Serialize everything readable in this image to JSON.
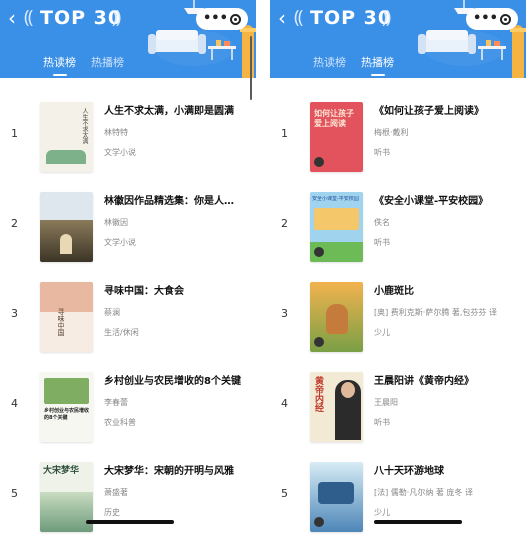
{
  "colors": {
    "header": "#3a8fe6",
    "tab_inactive": "#cfe4fb",
    "tab_active": "#ffffff"
  },
  "left_panel": {
    "back_icon": "chevron-left-icon",
    "title": "TOP 30",
    "tabs": [
      {
        "label": "热读榜",
        "active": true
      },
      {
        "label": "热播榜",
        "active": false
      }
    ],
    "books": [
      {
        "rank": "1",
        "title": "人生不求太满，小满即是圆满",
        "author": "林特特",
        "category": "文学小说"
      },
      {
        "rank": "2",
        "title": "林徽因作品精选集：你是人…",
        "author": "林徽因",
        "category": "文学小说"
      },
      {
        "rank": "3",
        "title": "寻味中国：大食会",
        "author": "蔡澜",
        "category": "生活/休闲"
      },
      {
        "rank": "4",
        "title": "乡村创业与农民增收的8个关键",
        "author": "李春蕾",
        "category": "农业科普"
      },
      {
        "rank": "5",
        "title": "大宋梦华：宋朝的开明与风雅",
        "author": "萧盛著",
        "category": "历史"
      }
    ]
  },
  "right_panel": {
    "back_icon": "chevron-left-icon",
    "title": "TOP 30",
    "tabs": [
      {
        "label": "热读榜",
        "active": false
      },
      {
        "label": "热播榜",
        "active": true
      }
    ],
    "books": [
      {
        "rank": "1",
        "title": "《如何让孩子爱上阅读》",
        "author": "梅根·戴利",
        "category": "听书"
      },
      {
        "rank": "2",
        "title": "《安全小课堂-平安校园》",
        "author": "佚名",
        "category": "听书"
      },
      {
        "rank": "3",
        "title": "小鹿斑比",
        "author": "[奥] 费利克斯·萨尔腾 著,包芬芬 译",
        "category": "少儿"
      },
      {
        "rank": "4",
        "title": "王晨阳讲《黄帝内经》",
        "author": "王晨阳",
        "category": "听书"
      },
      {
        "rank": "5",
        "title": "八十天环游地球",
        "author": "[法] 儒勒·凡尔纳 著 庞冬 译",
        "category": "少儿"
      }
    ]
  },
  "cover_text": {
    "l1": "人生不求太满",
    "l3": "寻味中国",
    "l4": "乡村创业与农民增收的8个关键",
    "l5": "大宋梦华",
    "r1": "如何让孩子爱上阅读",
    "r2": "安全小课堂-平安校园",
    "r4": "黄帝内经"
  }
}
